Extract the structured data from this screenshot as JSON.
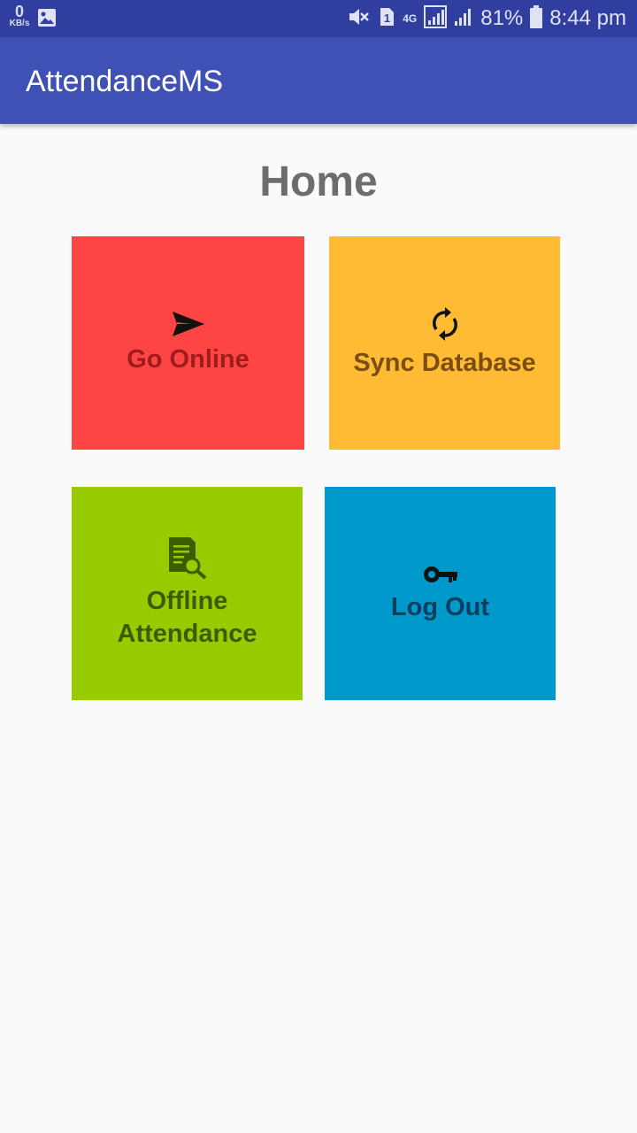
{
  "status_bar": {
    "net_speed": "0",
    "net_unit": "KB/s",
    "sim_slot": "1",
    "network_type": "4G",
    "battery": "81%",
    "time": "8:44 pm",
    "icons": [
      "gallery-icon",
      "mute-icon",
      "sim-icon",
      "signal-icon",
      "battery-icon"
    ]
  },
  "app_bar": {
    "title": "AttendanceMS"
  },
  "page": {
    "heading": "Home"
  },
  "tiles": [
    {
      "label": "Go Online",
      "icon": "send-icon",
      "bg": "#ff4444",
      "fg": "#a01c1c"
    },
    {
      "label": "Sync Database",
      "icon": "sync-icon",
      "bg": "#ffbb33",
      "fg": "#7a4e10"
    },
    {
      "label": "Offline Attendance",
      "icon": "document-search-icon",
      "bg": "#99cc00",
      "fg": "#3d5c00"
    },
    {
      "label": "Log Out",
      "icon": "key-icon",
      "bg": "#0099cc",
      "fg": "#0b3f60"
    }
  ]
}
